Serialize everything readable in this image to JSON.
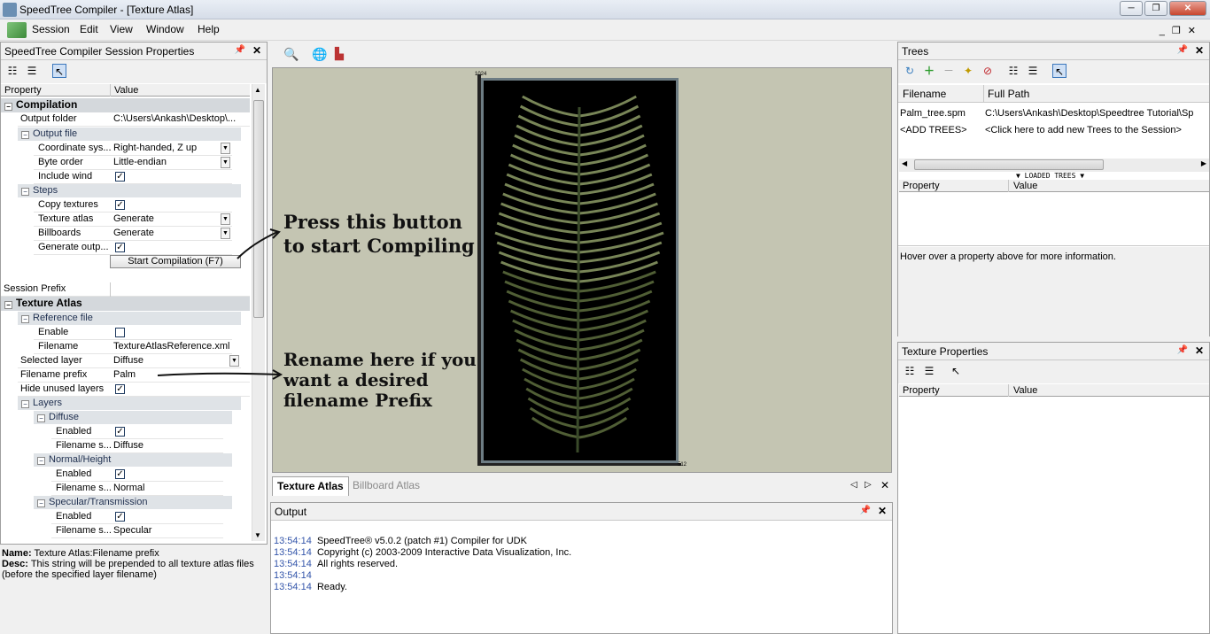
{
  "window": {
    "title": "SpeedTree Compiler - [Texture Atlas]"
  },
  "menu": [
    "Session",
    "Edit",
    "View",
    "Window",
    "Help"
  ],
  "left_panel": {
    "title": "SpeedTree Compiler Session Properties",
    "col_property": "Property",
    "col_value": "Value",
    "compilation": {
      "label": "Compilation",
      "output_folder_label": "Output folder",
      "output_folder_value": "C:\\Users\\Ankash\\Desktop\\...",
      "output_file_label": "Output file",
      "coord_label": "Coordinate sys...",
      "coord_value": "Right-handed, Z up",
      "byte_label": "Byte order",
      "byte_value": "Little-endian",
      "wind_label": "Include wind",
      "steps_label": "Steps",
      "copy_label": "Copy textures",
      "atlas_label": "Texture atlas",
      "atlas_value": "Generate",
      "billboards_label": "Billboards",
      "billboards_value": "Generate",
      "genout_label": "Generate outp...",
      "start_button": "Start Compilation (F7)"
    },
    "session_prefix_label": "Session Prefix",
    "texture_atlas": {
      "label": "Texture Atlas",
      "ref_label": "Reference file",
      "enable_label": "Enable",
      "filename_label": "Filename",
      "filename_value": "TextureAtlasReference.xml",
      "sel_layer_label": "Selected layer",
      "sel_layer_value": "Diffuse",
      "prefix_label": "Filename prefix",
      "prefix_value": "Palm",
      "hide_label": "Hide unused layers",
      "layers_label": "Layers",
      "diffuse_label": "Diffuse",
      "enabled_label": "Enabled",
      "fname_s_label": "Filename s...",
      "diffuse_value": "Diffuse",
      "normal_label": "Normal/Height",
      "normal_value": "Normal",
      "spec_label": "Specular/Transmission",
      "spec_value": "Specular"
    },
    "desc": {
      "name_key": "Name:",
      "name_value": "Texture Atlas:Filename prefix",
      "desc_key": "Desc:",
      "desc_value": "This string will be prepended to all texture atlas files (before the specified layer filename)"
    }
  },
  "viewport": {
    "annotation1": "Press this button to start Compiling",
    "annotation2": "Rename here if you want a desired filename Prefix",
    "corner_top": "1024",
    "corner_bottom": "512"
  },
  "tabs": {
    "active": "Texture Atlas",
    "inactive": "Billboard Atlas"
  },
  "output": {
    "title": "Output",
    "lines": [
      {
        "time": "13:54:14",
        "text": "SpeedTree® v5.0.2 (patch #1) Compiler for UDK"
      },
      {
        "time": "13:54:14",
        "text": "Copyright (c) 2003-2009 Interactive Data Visualization, Inc."
      },
      {
        "time": "13:54:14",
        "text": "All rights reserved."
      },
      {
        "time": "13:54:14",
        "text": ""
      },
      {
        "time": "13:54:14",
        "text": "Ready."
      }
    ]
  },
  "trees": {
    "title": "Trees",
    "col_filename": "Filename",
    "col_fullpath": "Full Path",
    "rows": [
      {
        "filename": "Palm_tree.spm",
        "path": "C:\\Users\\Ankash\\Desktop\\Speedtree Tutorial\\Sp"
      },
      {
        "filename": "<ADD TREES>",
        "path": "<Click here to add new Trees to the Session>"
      }
    ],
    "loaded": "LOADED TREES",
    "col_property": "Property",
    "col_value": "Value",
    "hover_info": "Hover over a property above for more information."
  },
  "texture_props": {
    "title": "Texture Properties",
    "col_property": "Property",
    "col_value": "Value"
  }
}
